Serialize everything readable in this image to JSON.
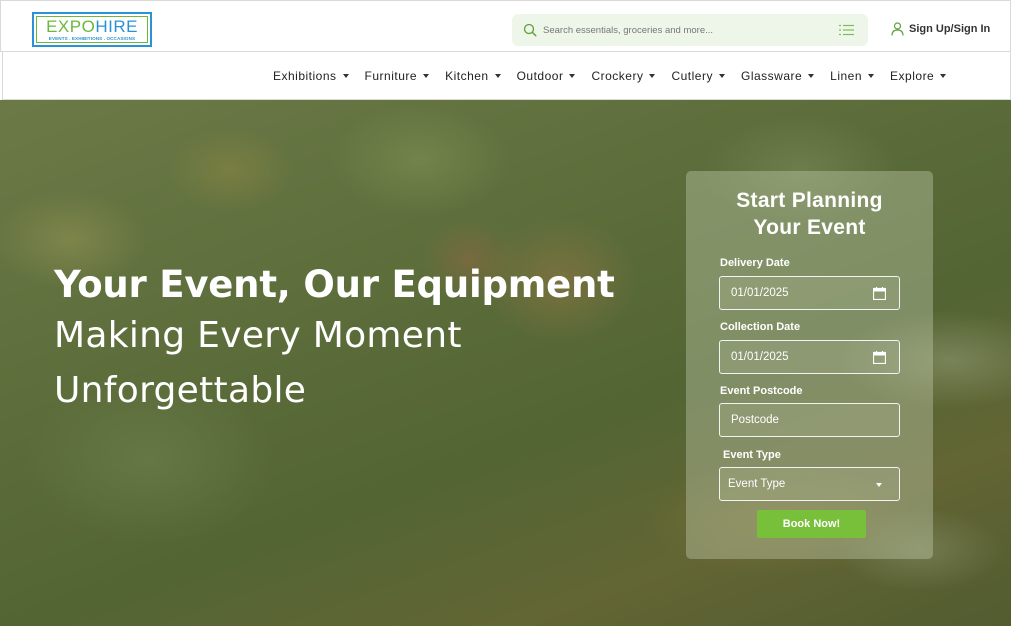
{
  "brand": {
    "logo_expo": "EXPO",
    "logo_hire": "HIRE",
    "logo_tagline": "EVENTS . EXHIBITIONS . OCCASIONS"
  },
  "header": {
    "search_placeholder": "Search essentials, groceries and more...",
    "signin_label": "Sign Up/Sign In"
  },
  "nav": {
    "items": [
      {
        "label": "Exhibitions"
      },
      {
        "label": "Furniture"
      },
      {
        "label": "Kitchen"
      },
      {
        "label": "Outdoor"
      },
      {
        "label": "Crockery"
      },
      {
        "label": "Cutlery"
      },
      {
        "label": "Glassware"
      },
      {
        "label": "Linen"
      },
      {
        "label": "Explore"
      }
    ]
  },
  "hero": {
    "headline": "Your Event, Our Equipment",
    "sub_line1": "Making Every Moment",
    "sub_line2": "Unforgettable"
  },
  "booking": {
    "title_line1": "Start Planning",
    "title_line2": "Your Event",
    "delivery_label": "Delivery Date",
    "delivery_value": "01/01/2025",
    "collection_label": "Collection Date",
    "collection_value": "01/01/2025",
    "postcode_label": "Event Postcode",
    "postcode_placeholder": "Postcode",
    "event_type_label": "Event Type",
    "event_type_value": "Event Type",
    "book_button": "Book Now!"
  },
  "colors": {
    "brand_green": "#78c03a",
    "brand_blue": "#2a93d5",
    "search_bg": "#eef6ea"
  }
}
